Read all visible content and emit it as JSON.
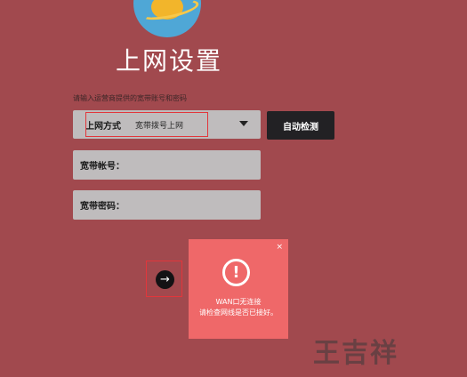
{
  "header": {
    "title": "上网设置",
    "logo_icon": "planet-icon"
  },
  "form": {
    "hint": "请输入运营商提供的宽带账号和密码",
    "connection_type": {
      "label": "上网方式",
      "value": "宽带拨号上网"
    },
    "account": {
      "label": "宽带帐号：",
      "value": ""
    },
    "password": {
      "label": "宽带密码：",
      "value": ""
    },
    "auto_detect_label": "自动检测",
    "next_icon": "arrow-right-icon",
    "next_glyph": "→"
  },
  "popup": {
    "close_glyph": "×",
    "alert_glyph": "!",
    "message_line1": "WAN口无连接",
    "message_line2": "请检查网线是否已接好。"
  },
  "watermark": "王吉祥",
  "colors": {
    "background": "#a1494e",
    "popup": "#ef6869",
    "highlight": "#e2363b",
    "button": "#222124"
  }
}
